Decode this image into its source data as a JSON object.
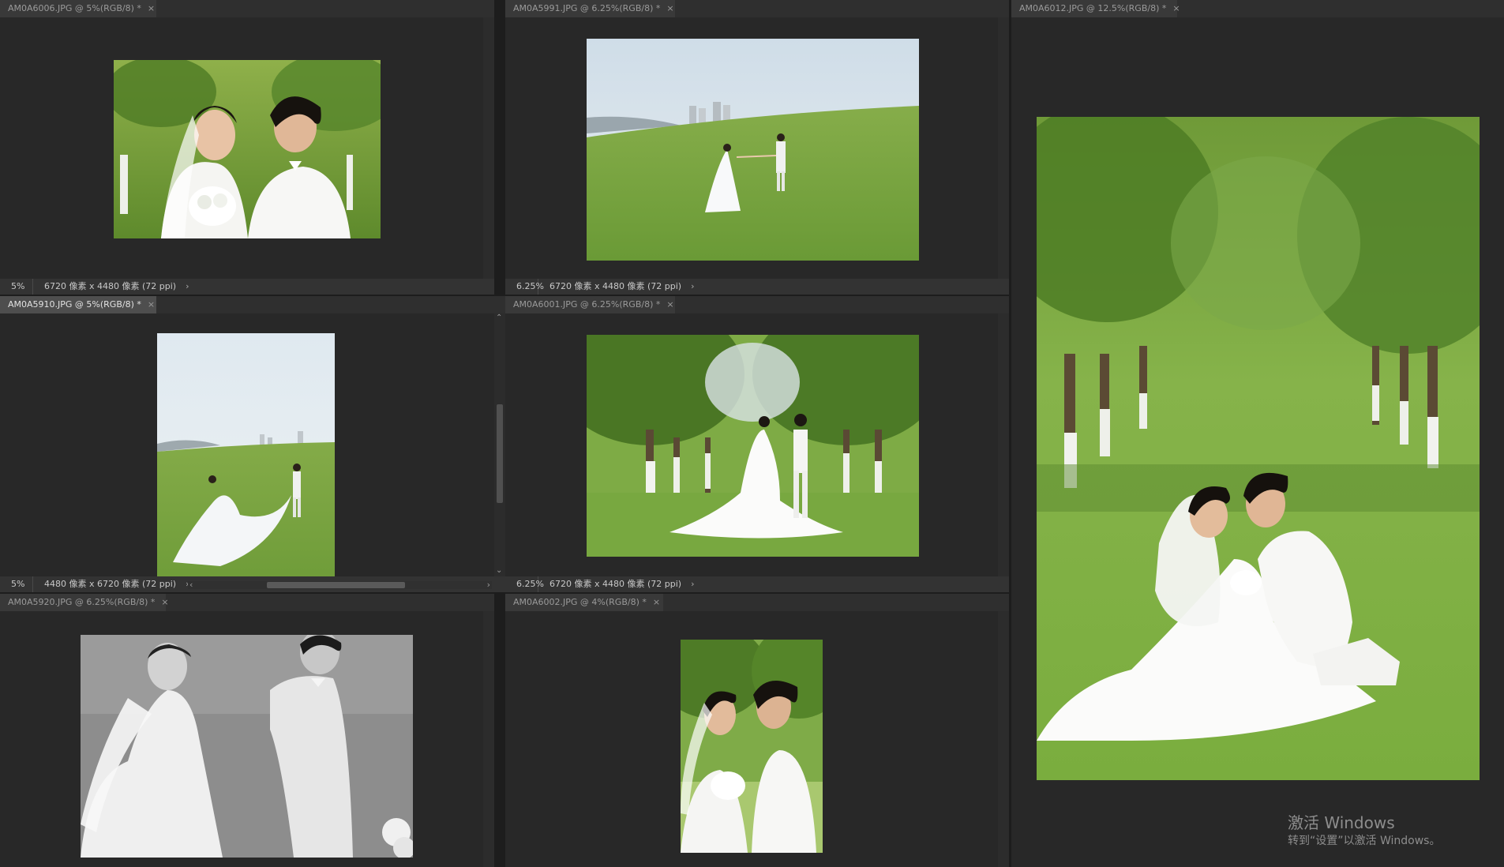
{
  "documents": [
    {
      "tab": "AM0A6006.JPG @ 5%(RGB/8) *",
      "zoom": "5%",
      "dims": "6720 像素 x 4480 像素 (72 ppi)",
      "active": false
    },
    {
      "tab": "AM0A5991.JPG @ 6.25%(RGB/8) *",
      "zoom": "6.25%",
      "dims": "6720 像素 x 4480 像素 (72 ppi)",
      "active": false
    },
    {
      "tab": "AM0A6012.JPG @ 12.5%(RGB/8) *",
      "active": false
    },
    {
      "tab": "AM0A5910.JPG @ 5%(RGB/8) *",
      "zoom": "5%",
      "dims": "4480 像素 x 6720 像素 (72 ppi)",
      "active": true
    },
    {
      "tab": "AM0A6001.JPG @ 6.25%(RGB/8) *",
      "zoom": "6.25%",
      "dims": "6720 像素 x 4480 像素 (72 ppi)",
      "active": false
    },
    {
      "tab": "AM0A5920.JPG @ 6.25%(RGB/8) *",
      "active": false
    },
    {
      "tab": "AM0A6002.JPG @ 4%(RGB/8) *",
      "active": false
    }
  ],
  "status_arrow": "›",
  "close_glyph": "×",
  "scroll_left": "‹",
  "scroll_right": "›",
  "scroll_up": "⌃",
  "scroll_down": "⌄",
  "watermark": {
    "line1": "激活 Windows",
    "line2": "转到“设置”以激活 Windows。"
  },
  "colors": {
    "tab_active": "#4e4e4e",
    "tab_inactive": "#393939",
    "canvas": "#282828",
    "status": "#333333"
  }
}
